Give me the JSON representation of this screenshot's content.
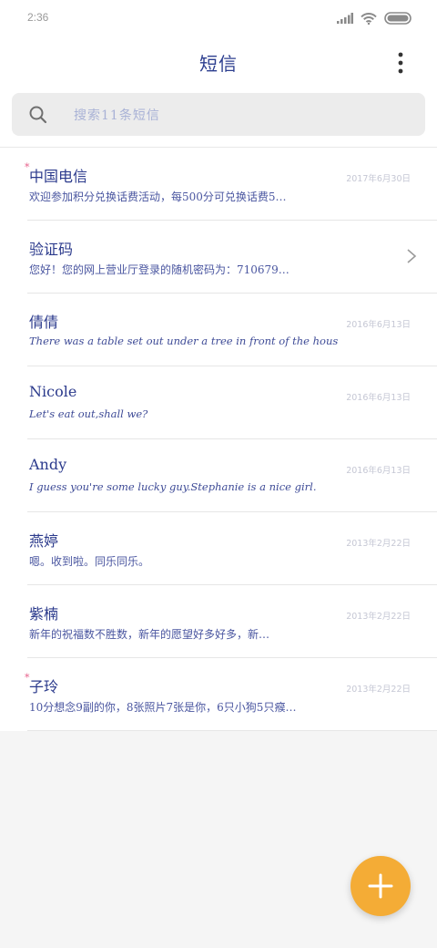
{
  "status_bar": {
    "time": "2:36"
  },
  "header": {
    "title": "短信"
  },
  "search": {
    "placeholder": "搜索11条短信"
  },
  "conversations": [
    {
      "name": "中国电信",
      "preview": "欢迎参加积分兑换话费活动，每500分可兑换话费5…",
      "date": "2017年6月30日",
      "marked": true
    },
    {
      "name": "验证码",
      "preview": "您好！您的网上营业厅登录的随机密码为：710679…",
      "date": "",
      "marked": false
    },
    {
      "name": "倩倩",
      "preview": "There was a table set out under a tree in front of the hous",
      "date": "2016年6月13日",
      "marked": false
    },
    {
      "name": "Nicole",
      "preview": "Let's eat out,shall we?",
      "date": "2016年6月13日",
      "marked": false
    },
    {
      "name": "Andy",
      "preview": "I guess you're some lucky guy.Stephanie is a nice girl.",
      "date": "2016年6月13日",
      "marked": false
    },
    {
      "name": "燕婷",
      "preview": "嗯。收到啦。同乐同乐。",
      "date": "2013年2月22日",
      "marked": false
    },
    {
      "name": "紫楠",
      "preview": "新年的祝福数不胜数，新年的愿望好多好多，新…",
      "date": "2013年2月22日",
      "marked": false
    },
    {
      "name": "子玲",
      "preview": "10分想念9副的你，8张照片7张是你，6只小狗5只瘊…",
      "date": "2013年2月22日",
      "marked": true
    }
  ],
  "icons": {
    "signal": "signal-icon",
    "wifi": "wifi-icon",
    "battery": "battery-icon",
    "more": "more-vertical-icon",
    "search": "search-icon",
    "chevron": "chevron-right-icon",
    "add": "plus-icon"
  },
  "colors": {
    "accent": "#f4ac36",
    "name_text": "#2b3a8c",
    "date_text": "#c5c7d4"
  }
}
